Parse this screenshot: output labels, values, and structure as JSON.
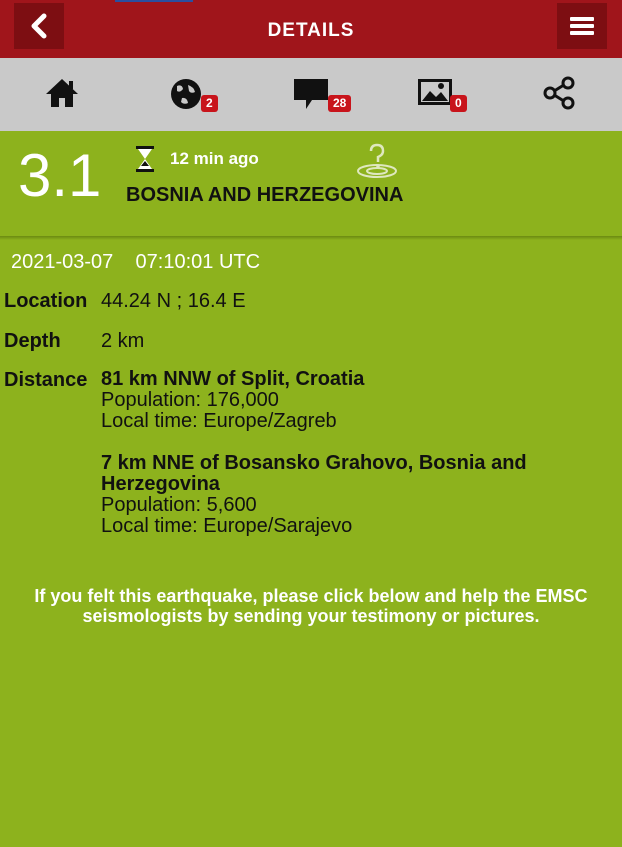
{
  "header": {
    "title": "DETAILS"
  },
  "toolbar": {
    "items": [
      {
        "icon": "home-icon"
      },
      {
        "icon": "globe-icon",
        "badge": "2"
      },
      {
        "icon": "comment-icon",
        "badge": "28"
      },
      {
        "icon": "picture-icon",
        "badge": "0"
      },
      {
        "icon": "share-icon"
      }
    ]
  },
  "summary": {
    "magnitude": "3.1",
    "time_ago": "12 min ago",
    "region": "BOSNIA AND HERZEGOVINA"
  },
  "details": {
    "date": "2021-03-07",
    "time": "07:10:01 UTC",
    "location_label": "Location",
    "location_value": "44.24 N ; 16.4 E",
    "depth_label": "Depth",
    "depth_value": "2 km",
    "distance_label": "Distance",
    "distances": [
      {
        "head": "81 km NNW of Split, Croatia",
        "population": "Population: 176,000",
        "local_time": "Local time: Europe/Zagreb"
      },
      {
        "head": "7 km NNE of Bosansko Grahovo, Bosnia and Herzegovina",
        "population": "Population: 5,600",
        "local_time": "Local time: Europe/Sarajevo"
      }
    ]
  },
  "felt_message": "If you felt this earthquake, please click below and help the EMSC seismologists by sending your testimony or pictures.",
  "colors": {
    "header_red": "#a0151b",
    "background_green": "#8db21d",
    "toolbar_gray": "#c9c9c9",
    "badge_red": "#c8141b"
  }
}
